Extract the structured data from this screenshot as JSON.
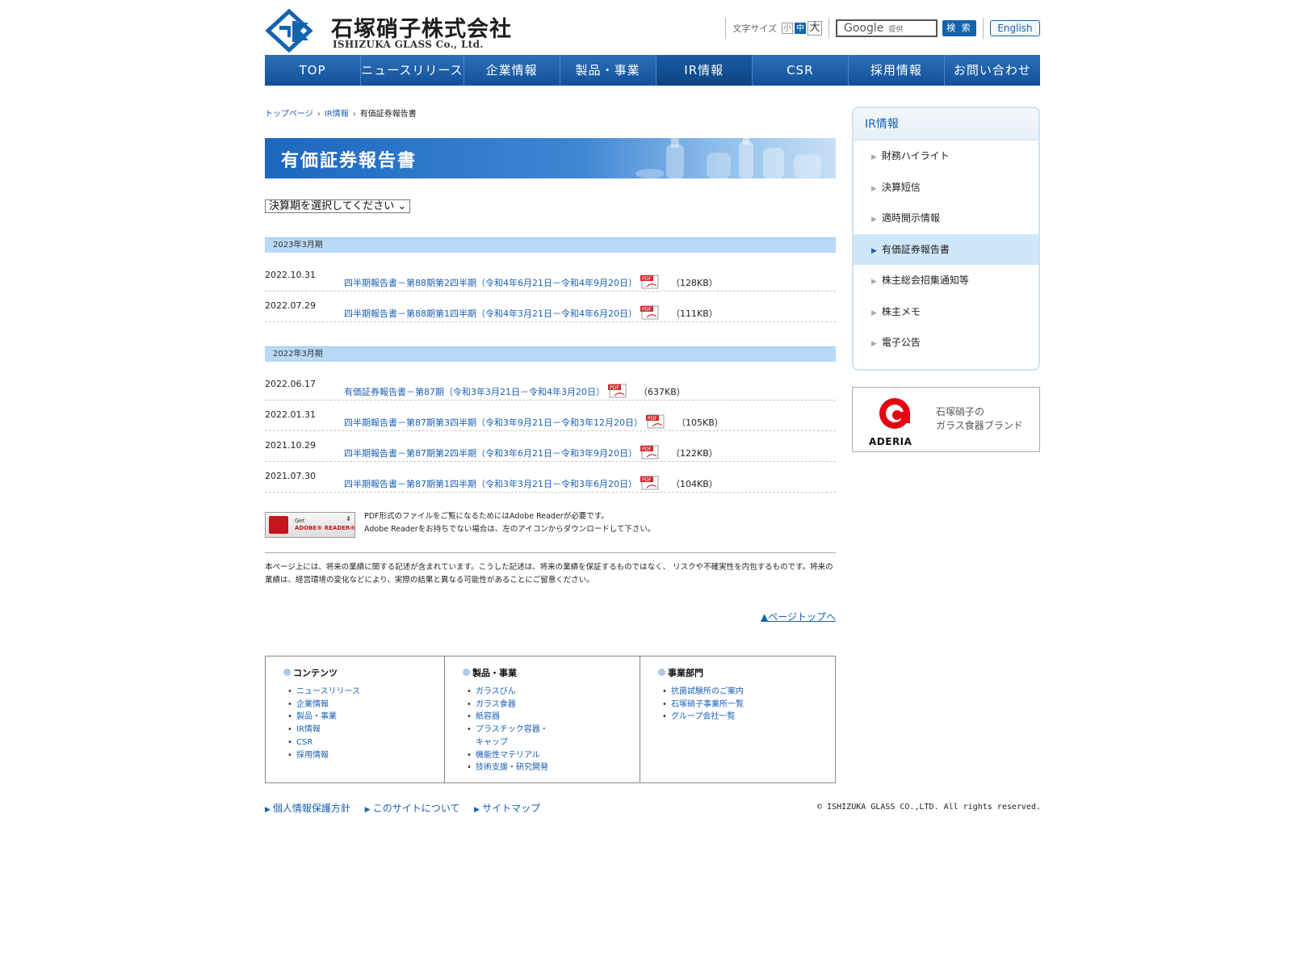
{
  "header": {
    "logo_jp": "石塚硝子株式会社",
    "logo_en": "ISHIZUKA GLASS Co., Ltd.",
    "font_size_label": "文字サイズ",
    "font_sizes": [
      "小",
      "中",
      "大"
    ],
    "search_brand": "Google",
    "search_provided": "提供",
    "search_button": "検 索",
    "english_button": "English"
  },
  "nav": {
    "items": [
      "TOP",
      "ニュースリリース",
      "企業情報",
      "製品・事業",
      "IR情報",
      "CSR",
      "採用情報",
      "お問い合わせ"
    ],
    "current": "IR情報"
  },
  "breadcrumb": {
    "home": "トップページ",
    "ir": "IR情報",
    "current": "有価証券報告書"
  },
  "page_title": "有価証券報告書",
  "period_select": "決算期を選択してください",
  "groups": [
    {
      "heading": "2023年3月期",
      "rows": [
        {
          "date": "2022.10.31",
          "title": "四半期報告書－第88期第2四半期（令和4年6月21日－令和4年9月20日）",
          "size": "（128KB）"
        },
        {
          "date": "2022.07.29",
          "title": "四半期報告書－第88期第1四半期（令和4年3月21日－令和4年6月20日）",
          "size": "（111KB）"
        }
      ]
    },
    {
      "heading": "2022年3月期",
      "rows": [
        {
          "date": "2022.06.17",
          "title": "有価証券報告書－第87期（令和3年3月21日－令和4年3月20日）",
          "size": "（637KB）"
        },
        {
          "date": "2022.01.31",
          "title": "四半期報告書－第87期第3四半期（令和3年9月21日－令和3年12月20日）",
          "size": "（105KB）"
        },
        {
          "date": "2021.10.29",
          "title": "四半期報告書－第87期第2四半期（令和3年6月21日－令和3年9月20日）",
          "size": "（122KB）"
        },
        {
          "date": "2021.07.30",
          "title": "四半期報告書－第87期第1四半期（令和3年3月21日－令和3年6月20日）",
          "size": "（104KB）"
        }
      ]
    }
  ],
  "pdf_label": "PDF",
  "reader": {
    "badge_get": "Get",
    "badge_name": "ADOBE® READER®",
    "line1": "PDF形式のファイルをご覧になるためにはAdobe Readerが必要です。",
    "line2": "Adobe Readerをお持ちでない場合は、左のアイコンからダウンロードして下さい。"
  },
  "disclaimer": "本ページ上には、将来の業績に関する記述が含まれています。こうした記述は、将来の業績を保証するものではなく、 リスクや不確実性を内包するものです。将来の業績は、経営環境の変化などにより、実際の結果と異なる可能性があることにご留意ください。",
  "pagetop": "▲ページトップへ",
  "sitemap": [
    {
      "heading": "コンテンツ",
      "items": [
        "ニュースリリース",
        "企業情報",
        "製品・事業",
        "IR情報",
        "CSR",
        "採用情報"
      ]
    },
    {
      "heading": "製品・事業",
      "items": [
        "ガラスびん",
        "ガラス食器",
        "紙容器",
        "プラスチック容器・キャップ",
        "機能性マテリアル",
        "技術支援・研究開発"
      ]
    },
    {
      "heading": "事業部門",
      "items": [
        "抗菌試験所のご案内",
        "石塚硝子事業所一覧",
        "グループ会社一覧"
      ]
    }
  ],
  "footer": {
    "links": [
      "個人情報保護方針",
      "このサイトについて",
      "サイトマップ"
    ],
    "copyright": "© ISHIZUKA GLASS CO.,LTD. All rights reserved."
  },
  "sidebar": {
    "heading": "IR情報",
    "items": [
      "財務ハイライト",
      "決算短信",
      "適時開示情報",
      "有価証券報告書",
      "株主総会招集通知等",
      "株主メモ",
      "電子公告"
    ],
    "current": "有価証券報告書",
    "banner_brand": "ADERIA",
    "banner_caption_1": "石塚硝子の",
    "banner_caption_2": "ガラス食器ブランド"
  },
  "colors": {
    "brand_blue": "#1464ad",
    "link": "#1a5fb4",
    "group_head_bg": "#b9daf6",
    "aderia_red": "#e50012"
  }
}
